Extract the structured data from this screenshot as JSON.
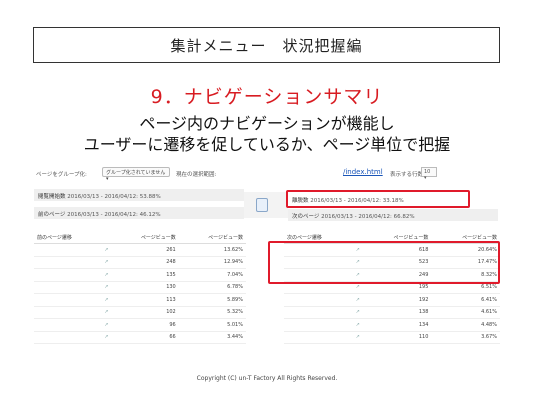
{
  "header": {
    "title": "集計メニュー　状況把握編"
  },
  "section_title": "9．ナビゲーションサマリ",
  "subtitle": {
    "line1": "ページ内のナビゲーションが機能し",
    "line2": "ユーザーに遷移を促しているか、ページ単位で把握"
  },
  "analytics": {
    "group_label": "ページをグループ化:",
    "group_select": "グループ化されていません ▾",
    "selection_label": "現在の選択範囲:",
    "page_path": "/index.html",
    "rows_label": "表示する行数:",
    "rows_value": "10 ▾",
    "entrance_label": "閲覧開始数",
    "entrance_stat": "2016/03/13 - 2016/04/12: 53.88%",
    "previous_label": "前のページ",
    "previous_stat": "2016/03/13 - 2016/04/12: 46.12%",
    "exit_label": "離脱数",
    "exit_stat": "2016/03/13 - 2016/04/12: 33.18%",
    "next_label": "次のページ",
    "next_stat": "2016/03/13 - 2016/04/12: 66.82%",
    "left_table": {
      "col_path": "前のページ遷移",
      "col_views": "ページビュー数",
      "col_pct": "ページビュー数",
      "rows": [
        {
          "views": "261",
          "pct": "13.62%"
        },
        {
          "views": "248",
          "pct": "12.94%"
        },
        {
          "views": "135",
          "pct": "7.04%"
        },
        {
          "views": "130",
          "pct": "6.78%"
        },
        {
          "views": "113",
          "pct": "5.89%"
        },
        {
          "views": "102",
          "pct": "5.32%"
        },
        {
          "views": "96",
          "pct": "5.01%"
        },
        {
          "views": "66",
          "pct": "3.44%"
        }
      ]
    },
    "right_table": {
      "col_path": "次のページ遷移",
      "col_views": "ページビュー数",
      "col_pct": "ページビュー数",
      "rows": [
        {
          "views": "618",
          "pct": "20.64%"
        },
        {
          "views": "523",
          "pct": "17.47%"
        },
        {
          "views": "249",
          "pct": "8.32%"
        },
        {
          "views": "195",
          "pct": "6.51%"
        },
        {
          "views": "192",
          "pct": "6.41%"
        },
        {
          "views": "138",
          "pct": "4.61%"
        },
        {
          "views": "134",
          "pct": "4.48%"
        },
        {
          "views": "110",
          "pct": "3.67%"
        }
      ]
    }
  },
  "footer": {
    "copyright": "Copyright (C) un-T Factory  All Rights Reserved."
  },
  "colors": {
    "accent_red": "#d81c22",
    "highlight_red": "#e01a2b",
    "link_blue": "#1a55b8"
  }
}
